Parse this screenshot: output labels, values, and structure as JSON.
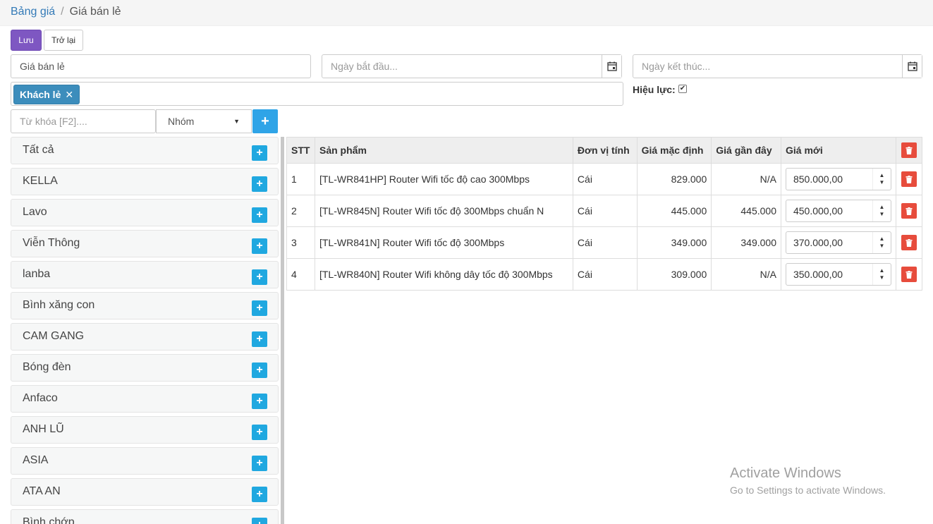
{
  "breadcrumb": {
    "link": "Bảng giá",
    "separator": "/",
    "current": "Giá bán lẻ"
  },
  "toolbar": {
    "save_label": "Lưu",
    "back_label": "Trở lại"
  },
  "form": {
    "name_value": "Giá bán lẻ",
    "start_date_placeholder": "Ngày bắt đầu...",
    "end_date_placeholder": "Ngày kết thúc...",
    "customer_tag": "Khách lẻ",
    "valid_label": "Hiệu lực:",
    "valid_checked": true
  },
  "search": {
    "keyword_placeholder": "Từ khóa [F2]....",
    "group_select": "Nhóm"
  },
  "groups": [
    "Tất cả",
    "KELLA",
    "Lavo",
    "Viễn Thông",
    "lanba",
    "Bình xăng con",
    "CAM GANG",
    "Bóng đèn",
    "Anfaco",
    "ANH LŨ",
    "ASIA",
    "ATA AN",
    "Bình chớp"
  ],
  "table": {
    "headers": [
      "STT",
      "Sản phẩm",
      "Đơn vị tính",
      "Giá mặc định",
      "Giá gần đây",
      "Giá mới"
    ],
    "rows": [
      {
        "stt": "1",
        "product": "[TL-WR841HP] Router Wifi tốc độ cao 300Mbps",
        "unit": "Cái",
        "default_price": "829.000",
        "recent_price": "N/A",
        "new_price": "850.000,00"
      },
      {
        "stt": "2",
        "product": "[TL-WR845N] Router Wifi tốc độ 300Mbps chuẩn N",
        "unit": "Cái",
        "default_price": "445.000",
        "recent_price": "445.000",
        "new_price": "450.000,00"
      },
      {
        "stt": "3",
        "product": "[TL-WR841N] Router Wifi tốc độ 300Mbps",
        "unit": "Cái",
        "default_price": "349.000",
        "recent_price": "349.000",
        "new_price": "370.000,00"
      },
      {
        "stt": "4",
        "product": "[TL-WR840N] Router Wifi không dây tốc độ 300Mbps",
        "unit": "Cái",
        "default_price": "309.000",
        "recent_price": "N/A",
        "new_price": "350.000,00"
      }
    ]
  },
  "watermark": {
    "title": "Activate Windows",
    "subtitle": "Go to Settings to activate Windows."
  },
  "colors": {
    "primary": "#7e57c2",
    "info": "#20a8e0",
    "danger": "#e74c3c",
    "tag": "#3c8dbc"
  }
}
